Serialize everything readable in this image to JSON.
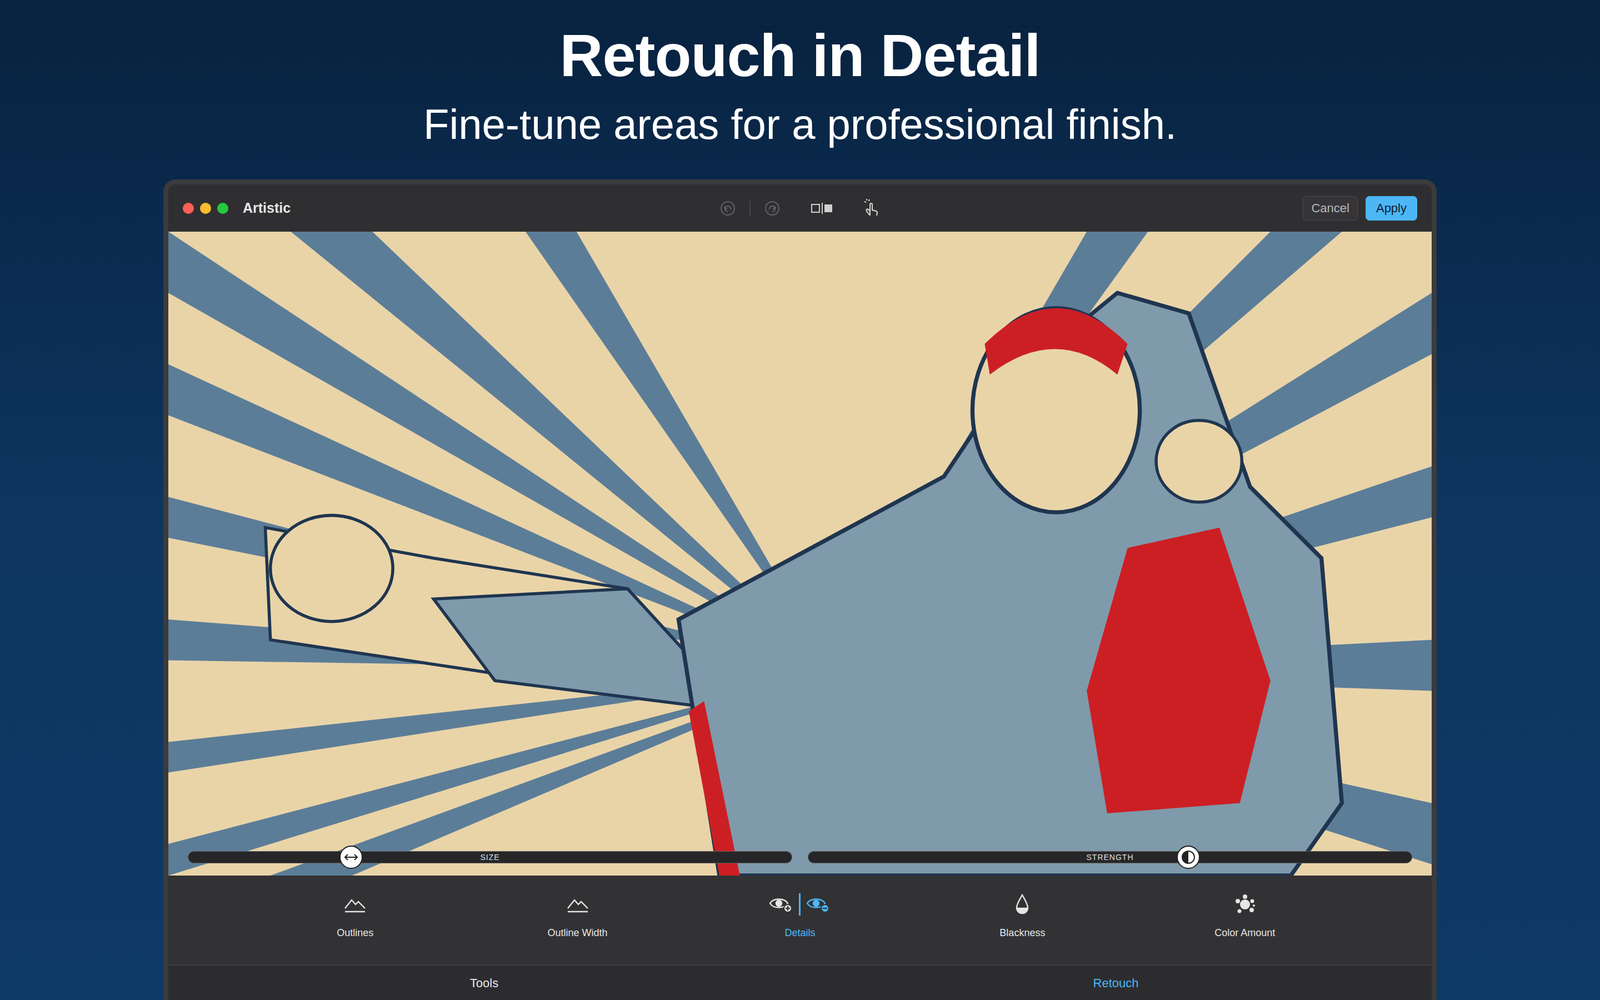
{
  "headline": "Retouch in Detail",
  "subheadline": "Fine-tune areas for a professional finish.",
  "window": {
    "title": "Artistic"
  },
  "history": {
    "undo_disabled": true,
    "redo_disabled": true
  },
  "buttons": [
    {
      "label": "Cancel",
      "kind": "secondary"
    },
    {
      "label": "Apply",
      "kind": "primary"
    }
  ],
  "sliders": [
    {
      "label": "SIZE",
      "level": 0.27,
      "kind": "size"
    },
    {
      "label": "STRENGTH",
      "level": 0.63,
      "kind": "strength"
    }
  ],
  "tools": [
    {
      "label": "Outlines",
      "selected": false,
      "kind": "mountain"
    },
    {
      "label": "Outline Width",
      "selected": false,
      "kind": "mountain"
    },
    {
      "label": "Details",
      "selected": true,
      "kind": "eyes"
    },
    {
      "label": "Blackness",
      "selected": false,
      "kind": "drop"
    },
    {
      "label": "Color Amount",
      "selected": false,
      "kind": "splat"
    }
  ],
  "tabs": [
    {
      "label": "Tools",
      "selected": false
    },
    {
      "label": "Retouch",
      "selected": true
    }
  ]
}
